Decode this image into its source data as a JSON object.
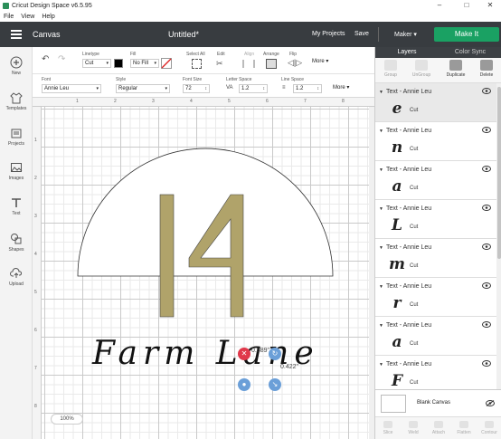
{
  "window": {
    "title": "Cricut Design Space  v6.5.95",
    "controls": [
      "minimize-icon",
      "maximize-icon",
      "close-icon"
    ]
  },
  "menu": [
    "File",
    "View",
    "Help"
  ],
  "header": {
    "section": "Canvas",
    "doc_title": "Untitled*",
    "my_projects": "My Projects",
    "save": "Save",
    "machine": "Maker",
    "make_it": "Make It"
  },
  "sidebar": {
    "items": [
      {
        "label": "New",
        "icon": "plus-icon"
      },
      {
        "label": "Templates",
        "icon": "shirt-icon"
      },
      {
        "label": "Projects",
        "icon": "projects-icon"
      },
      {
        "label": "Images",
        "icon": "image-icon"
      },
      {
        "label": "Text",
        "icon": "text-icon"
      },
      {
        "label": "Shapes",
        "icon": "shapes-icon"
      },
      {
        "label": "Upload",
        "icon": "upload-cloud-icon"
      }
    ]
  },
  "toolbar": {
    "linetype_label": "Linetype",
    "linetype_value": "Cut",
    "fill_label": "Fill",
    "fill_value": "No Fill",
    "select_all": "Select All",
    "edit": "Edit",
    "align": "Align",
    "arrange": "Arrange",
    "flip": "Flip",
    "more": "More",
    "font_label": "Font",
    "font_value": "Annie Leu",
    "style_label": "Style",
    "style_value": "Regular",
    "font_size_label": "Font Size",
    "font_size_value": "72",
    "letter_space_label": "Letter Space",
    "letter_space_value": "1.2",
    "line_space_label": "Line Space",
    "line_space_value": "1.2",
    "more2": "More"
  },
  "ruler": {
    "top": [
      "1",
      "2",
      "3",
      "4",
      "5",
      "6",
      "7",
      "8"
    ],
    "left": [
      "1",
      "2",
      "3",
      "4",
      "5",
      "6",
      "7",
      "8"
    ]
  },
  "canvas": {
    "number_text": "14",
    "number_color": "#b0a36a",
    "script_text": "Farm Lane",
    "dim_w": "0.389\"",
    "dim_h": "0.422\"",
    "zoom": "100%"
  },
  "panel": {
    "tabs": [
      "Layers",
      "Color Sync"
    ],
    "tools": [
      "Group",
      "UnGroup",
      "Duplicate",
      "Delete"
    ],
    "layers": [
      {
        "name": "Text - Annie Leu",
        "glyph": "e",
        "op": "Cut"
      },
      {
        "name": "Text - Annie Leu",
        "glyph": "n",
        "op": "Cut"
      },
      {
        "name": "Text - Annie Leu",
        "glyph": "a",
        "op": "Cut"
      },
      {
        "name": "Text - Annie Leu",
        "glyph": "L",
        "op": "Cut"
      },
      {
        "name": "Text - Annie Leu",
        "glyph": "m",
        "op": "Cut"
      },
      {
        "name": "Text - Annie Leu",
        "glyph": "r",
        "op": "Cut"
      },
      {
        "name": "Text - Annie Leu",
        "glyph": "a",
        "op": "Cut"
      },
      {
        "name": "Text - Annie Leu",
        "glyph": "F",
        "op": "Cut"
      }
    ],
    "blank_canvas": "Blank Canvas",
    "bottom_tools": [
      "Slice",
      "Weld",
      "Attach",
      "Flatten",
      "Contour"
    ]
  }
}
